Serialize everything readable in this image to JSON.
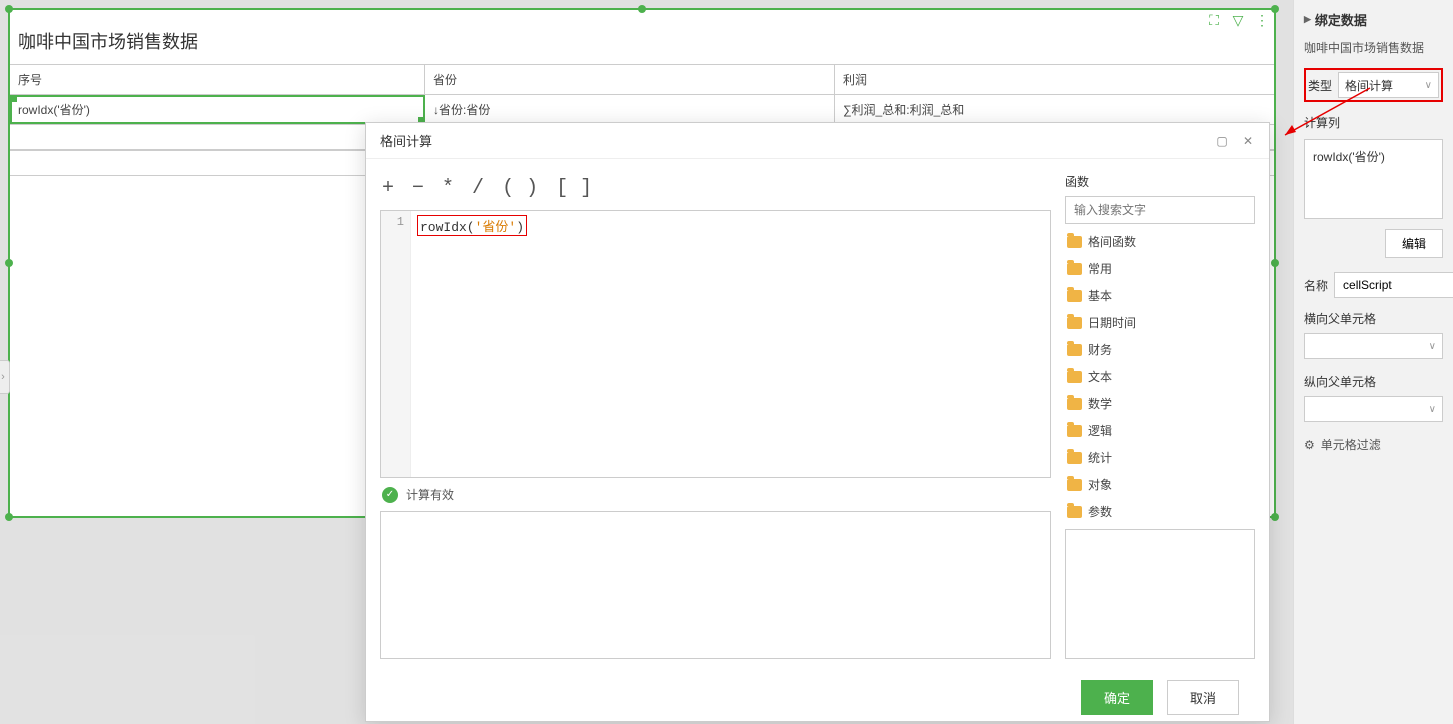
{
  "report": {
    "title": "咖啡中国市场销售数据",
    "columns": {
      "c1_header": "序号",
      "c2_header": "省份",
      "c3_header": "利润",
      "c1_data": "rowIdx('省份')",
      "c2_data": "↓省份:省份",
      "c3_data": "∑利润_总和:利润_总和"
    }
  },
  "rightPanel": {
    "title": "绑定数据",
    "subtitle": "咖啡中国市场销售数据",
    "typeLabel": "类型",
    "typeValue": "格间计算",
    "calcColLabel": "计算列",
    "calcValue": "rowIdx('省份')",
    "editBtn": "编辑",
    "nameLabel": "名称",
    "nameValue": "cellScript",
    "hParentLabel": "横向父单元格",
    "vParentLabel": "纵向父单元格",
    "filterLabel": "单元格过滤"
  },
  "modal": {
    "title": "格间计算",
    "ops": {
      "plus": "+",
      "minus": "−",
      "star": "*",
      "slash": "/",
      "paren": "( )",
      "bracket": "[ ]"
    },
    "lineNum": "1",
    "codePrefix": "rowIdx(",
    "codeArg": "'省份'",
    "codeSuffix": ")",
    "validText": "计算有效",
    "funcTitle": "函数",
    "searchPlaceholder": "输入搜索文字",
    "funcCategories": [
      "格间函数",
      "常用",
      "基本",
      "日期时间",
      "财务",
      "文本",
      "数学",
      "逻辑",
      "统计",
      "对象",
      "参数"
    ],
    "confirm": "确定",
    "cancel": "取消"
  }
}
